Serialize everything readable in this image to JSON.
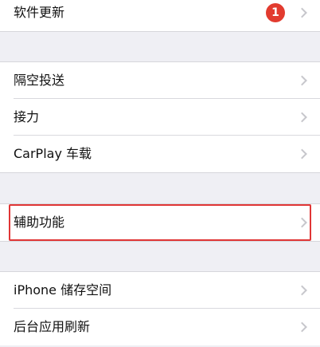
{
  "settings": {
    "software_update": {
      "label": "软件更新",
      "badge": "1"
    },
    "airdrop": {
      "label": "隔空投送"
    },
    "handoff": {
      "label": "接力"
    },
    "carplay": {
      "label": "CarPlay 车载"
    },
    "accessibility": {
      "label": "辅助功能",
      "highlighted": true
    },
    "iphone_storage": {
      "label": "iPhone 储存空间"
    },
    "background_refresh": {
      "label": "后台应用刷新"
    }
  },
  "colors": {
    "badge": "#e23b2f",
    "highlight_border": "#e03636",
    "group_background": "#efeff4",
    "chevron": "#c7c7cc"
  },
  "icons": [
    "chevron-right-icon"
  ]
}
